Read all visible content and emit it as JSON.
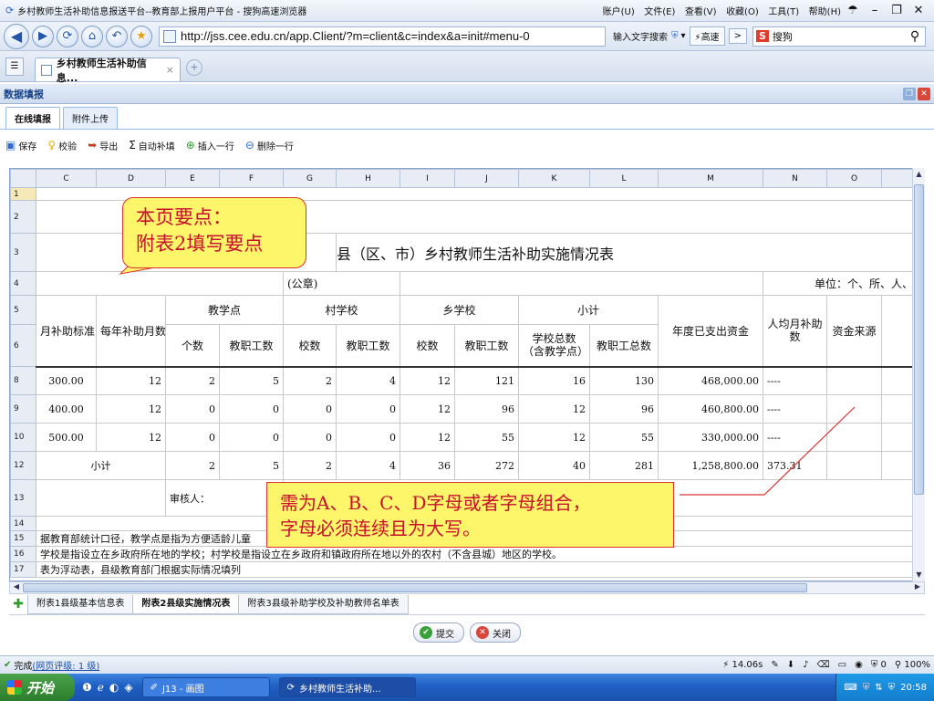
{
  "window": {
    "title": "乡村教师生活补助信息报送平台--教育部上报用户平台 - 搜狗高速浏览器",
    "menu": [
      "账户(U)",
      "文件(E)",
      "查看(V)",
      "收藏(O)",
      "工具(T)",
      "帮助(H)"
    ]
  },
  "address": {
    "url": "http://jss.cee.edu.cn/app.Client/?m=client&c=index&a=init#menu-0",
    "input_hint": "输入文字搜索",
    "speed": "高速",
    "search_engine": "S",
    "search_placeholder": "搜狗"
  },
  "browser_tab": {
    "label": "乡村教师生活补助信息...",
    "close": "×"
  },
  "panel": {
    "title": "数据填报"
  },
  "subtabs": [
    "在线填报",
    "附件上传"
  ],
  "toolbar": {
    "save": "保存",
    "check": "校验",
    "export": "导出",
    "autofill": "自动补填",
    "insert_row": "插入一行",
    "delete_row": "删除一行"
  },
  "sheet": {
    "col_letters": [
      "C",
      "D",
      "E",
      "F",
      "G",
      "H",
      "I",
      "J",
      "K",
      "L",
      "M",
      "N",
      "O"
    ],
    "row_numbers": [
      "1",
      "2",
      "3",
      "4",
      "5",
      "6",
      "8",
      "9",
      "10",
      "12",
      "13",
      "14",
      "15",
      "16",
      "17"
    ],
    "title": "县（区、市）乡村教师生活补助实施情况表",
    "seal": "(公章)",
    "unit": "单位：个、所、人、元",
    "headers": {
      "monthly_std": "月补助标准",
      "months": "每年补助月数",
      "teaching_point": "教学点",
      "village_school": "村学校",
      "town_school": "乡学校",
      "subtotal": "小计",
      "annual_spent": "年度已支出资金",
      "per_capita": "人均月补助数",
      "fund_source": "资金来源",
      "count": "个数",
      "staff": "教职工数",
      "schools": "校数",
      "total_schools": "学校总数（含教学点）",
      "total_staff": "教职工总数"
    },
    "rows": [
      {
        "std": "300.00",
        "months": "12",
        "tp_n": "2",
        "tp_s": "5",
        "vs_n": "2",
        "vs_s": "4",
        "ts_n": "12",
        "ts_s": "121",
        "tot_n": "16",
        "tot_s": "130",
        "spent": "468,000.00",
        "per": "----"
      },
      {
        "std": "400.00",
        "months": "12",
        "tp_n": "0",
        "tp_s": "0",
        "vs_n": "0",
        "vs_s": "0",
        "ts_n": "12",
        "ts_s": "96",
        "tot_n": "12",
        "tot_s": "96",
        "spent": "460,800.00",
        "per": "----"
      },
      {
        "std": "500.00",
        "months": "12",
        "tp_n": "0",
        "tp_s": "0",
        "vs_n": "0",
        "vs_s": "0",
        "ts_n": "12",
        "ts_s": "55",
        "tot_n": "12",
        "tot_s": "55",
        "spent": "330,000.00",
        "per": "----"
      }
    ],
    "total": {
      "label": "小计",
      "tp_n": "2",
      "tp_s": "5",
      "vs_n": "2",
      "vs_s": "4",
      "ts_n": "36",
      "ts_s": "272",
      "tot_n": "40",
      "tot_s": "281",
      "spent": "1,258,800.00",
      "per": "373.31"
    },
    "reviewer": "审核人：",
    "notes": [
      "据教育部统计口径，教学点是指为方便适龄儿童",
      "学校是指设立在乡政府所在地的学校；村学校是指设立在乡政府和镇政府所在地以外的农村（不含县城）地区的学校。",
      "表为浮动表，县级教育部门根据实际情况填列"
    ]
  },
  "sheet_tabs": [
    "附表1县级基本信息表",
    "附表2县级实施情况表",
    "附表3县级补助学校及补助教师名单表"
  ],
  "buttons": {
    "submit": "提交",
    "close": "关闭"
  },
  "status": {
    "done": "完成",
    "rating": "(网页评级: 1 级)",
    "time": "14.06s",
    "zoom": "100%",
    "count": "0"
  },
  "taskbar": {
    "start": "开始",
    "task1": "J13 - 画图",
    "task2": "乡村教师生活补助...",
    "clock": "20:58"
  },
  "callouts": {
    "note1_line1": "本页要点：",
    "note1_line2": "附表2填写要点",
    "note2_line1": "需为A、B、C、D字母或者字母组合，",
    "note2_line2": "字母必须连续且为大写。"
  }
}
